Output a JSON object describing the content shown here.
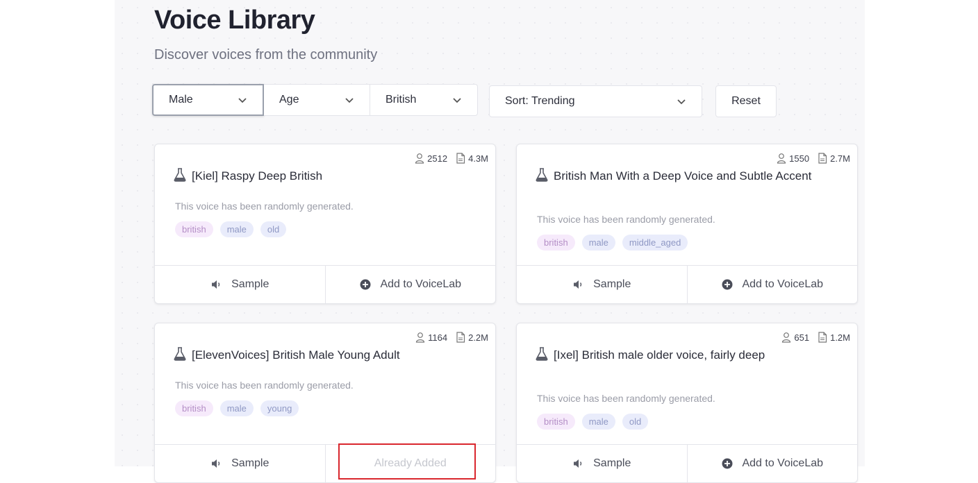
{
  "header": {
    "title": "Voice Library",
    "subtitle": "Discover voices from the community"
  },
  "filters": {
    "gender": "Male",
    "age": "Age",
    "accent": "British",
    "sort": "Sort: Trending",
    "reset_label": "Reset"
  },
  "cards": [
    {
      "title": "[Kiel] Raspy Deep British",
      "users": "2512",
      "size": "4.3M",
      "description": "This voice has been randomly generated.",
      "tags": [
        "british",
        "male",
        "old"
      ],
      "sample_label": "Sample",
      "add_label": "Add to VoiceLab",
      "added": false
    },
    {
      "title": "British Man With a Deep Voice and Subtle Accent",
      "users": "1550",
      "size": "2.7M",
      "description": "This voice has been randomly generated.",
      "tags": [
        "british",
        "male",
        "middle_aged"
      ],
      "sample_label": "Sample",
      "add_label": "Add to VoiceLab",
      "added": false
    },
    {
      "title": "[ElevenVoices] British Male Young Adult",
      "users": "1164",
      "size": "2.2M",
      "description": "This voice has been randomly generated.",
      "tags": [
        "british",
        "male",
        "young"
      ],
      "sample_label": "Sample",
      "add_label": "Already Added",
      "added": true
    },
    {
      "title": "[Ixel] British male older voice, fairly deep",
      "users": "651",
      "size": "1.2M",
      "description": "This voice has been randomly generated.",
      "tags": [
        "british",
        "male",
        "old"
      ],
      "sample_label": "Sample",
      "add_label": "Add to VoiceLab",
      "added": false
    }
  ],
  "colors": {
    "highlight": "#d9262d",
    "tag_pink_bg": "#f6eafb",
    "tag_blue_bg": "#e9ecfb"
  },
  "icons": {
    "user": "user-icon",
    "file": "file-icon",
    "flask": "flask-icon",
    "speaker": "speaker-icon",
    "add": "plus-circle-icon",
    "chevron": "chevron-down-icon"
  }
}
